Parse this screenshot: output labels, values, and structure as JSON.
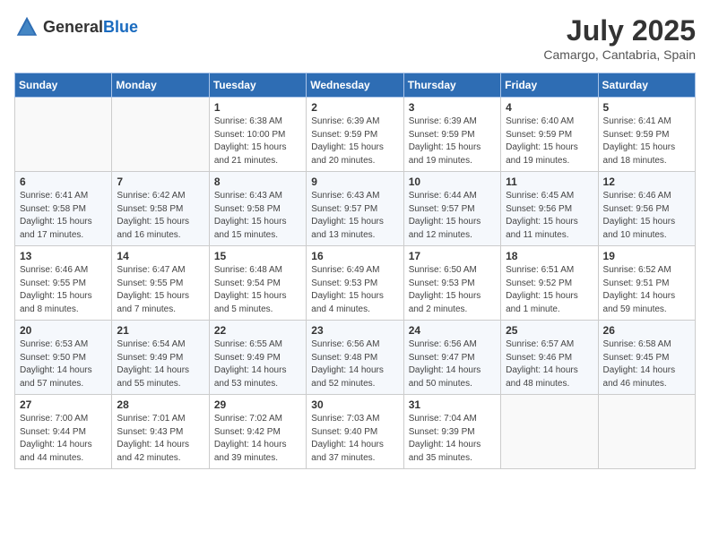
{
  "header": {
    "logo_general": "General",
    "logo_blue": "Blue",
    "month_year": "July 2025",
    "location": "Camargo, Cantabria, Spain"
  },
  "calendar": {
    "days_of_week": [
      "Sunday",
      "Monday",
      "Tuesday",
      "Wednesday",
      "Thursday",
      "Friday",
      "Saturday"
    ],
    "weeks": [
      [
        {
          "day": "",
          "info": ""
        },
        {
          "day": "",
          "info": ""
        },
        {
          "day": "1",
          "info": "Sunrise: 6:38 AM\nSunset: 10:00 PM\nDaylight: 15 hours\nand 21 minutes."
        },
        {
          "day": "2",
          "info": "Sunrise: 6:39 AM\nSunset: 9:59 PM\nDaylight: 15 hours\nand 20 minutes."
        },
        {
          "day": "3",
          "info": "Sunrise: 6:39 AM\nSunset: 9:59 PM\nDaylight: 15 hours\nand 19 minutes."
        },
        {
          "day": "4",
          "info": "Sunrise: 6:40 AM\nSunset: 9:59 PM\nDaylight: 15 hours\nand 19 minutes."
        },
        {
          "day": "5",
          "info": "Sunrise: 6:41 AM\nSunset: 9:59 PM\nDaylight: 15 hours\nand 18 minutes."
        }
      ],
      [
        {
          "day": "6",
          "info": "Sunrise: 6:41 AM\nSunset: 9:58 PM\nDaylight: 15 hours\nand 17 minutes."
        },
        {
          "day": "7",
          "info": "Sunrise: 6:42 AM\nSunset: 9:58 PM\nDaylight: 15 hours\nand 16 minutes."
        },
        {
          "day": "8",
          "info": "Sunrise: 6:43 AM\nSunset: 9:58 PM\nDaylight: 15 hours\nand 15 minutes."
        },
        {
          "day": "9",
          "info": "Sunrise: 6:43 AM\nSunset: 9:57 PM\nDaylight: 15 hours\nand 13 minutes."
        },
        {
          "day": "10",
          "info": "Sunrise: 6:44 AM\nSunset: 9:57 PM\nDaylight: 15 hours\nand 12 minutes."
        },
        {
          "day": "11",
          "info": "Sunrise: 6:45 AM\nSunset: 9:56 PM\nDaylight: 15 hours\nand 11 minutes."
        },
        {
          "day": "12",
          "info": "Sunrise: 6:46 AM\nSunset: 9:56 PM\nDaylight: 15 hours\nand 10 minutes."
        }
      ],
      [
        {
          "day": "13",
          "info": "Sunrise: 6:46 AM\nSunset: 9:55 PM\nDaylight: 15 hours\nand 8 minutes."
        },
        {
          "day": "14",
          "info": "Sunrise: 6:47 AM\nSunset: 9:55 PM\nDaylight: 15 hours\nand 7 minutes."
        },
        {
          "day": "15",
          "info": "Sunrise: 6:48 AM\nSunset: 9:54 PM\nDaylight: 15 hours\nand 5 minutes."
        },
        {
          "day": "16",
          "info": "Sunrise: 6:49 AM\nSunset: 9:53 PM\nDaylight: 15 hours\nand 4 minutes."
        },
        {
          "day": "17",
          "info": "Sunrise: 6:50 AM\nSunset: 9:53 PM\nDaylight: 15 hours\nand 2 minutes."
        },
        {
          "day": "18",
          "info": "Sunrise: 6:51 AM\nSunset: 9:52 PM\nDaylight: 15 hours\nand 1 minute."
        },
        {
          "day": "19",
          "info": "Sunrise: 6:52 AM\nSunset: 9:51 PM\nDaylight: 14 hours\nand 59 minutes."
        }
      ],
      [
        {
          "day": "20",
          "info": "Sunrise: 6:53 AM\nSunset: 9:50 PM\nDaylight: 14 hours\nand 57 minutes."
        },
        {
          "day": "21",
          "info": "Sunrise: 6:54 AM\nSunset: 9:49 PM\nDaylight: 14 hours\nand 55 minutes."
        },
        {
          "day": "22",
          "info": "Sunrise: 6:55 AM\nSunset: 9:49 PM\nDaylight: 14 hours\nand 53 minutes."
        },
        {
          "day": "23",
          "info": "Sunrise: 6:56 AM\nSunset: 9:48 PM\nDaylight: 14 hours\nand 52 minutes."
        },
        {
          "day": "24",
          "info": "Sunrise: 6:56 AM\nSunset: 9:47 PM\nDaylight: 14 hours\nand 50 minutes."
        },
        {
          "day": "25",
          "info": "Sunrise: 6:57 AM\nSunset: 9:46 PM\nDaylight: 14 hours\nand 48 minutes."
        },
        {
          "day": "26",
          "info": "Sunrise: 6:58 AM\nSunset: 9:45 PM\nDaylight: 14 hours\nand 46 minutes."
        }
      ],
      [
        {
          "day": "27",
          "info": "Sunrise: 7:00 AM\nSunset: 9:44 PM\nDaylight: 14 hours\nand 44 minutes."
        },
        {
          "day": "28",
          "info": "Sunrise: 7:01 AM\nSunset: 9:43 PM\nDaylight: 14 hours\nand 42 minutes."
        },
        {
          "day": "29",
          "info": "Sunrise: 7:02 AM\nSunset: 9:42 PM\nDaylight: 14 hours\nand 39 minutes."
        },
        {
          "day": "30",
          "info": "Sunrise: 7:03 AM\nSunset: 9:40 PM\nDaylight: 14 hours\nand 37 minutes."
        },
        {
          "day": "31",
          "info": "Sunrise: 7:04 AM\nSunset: 9:39 PM\nDaylight: 14 hours\nand 35 minutes."
        },
        {
          "day": "",
          "info": ""
        },
        {
          "day": "",
          "info": ""
        }
      ]
    ]
  }
}
